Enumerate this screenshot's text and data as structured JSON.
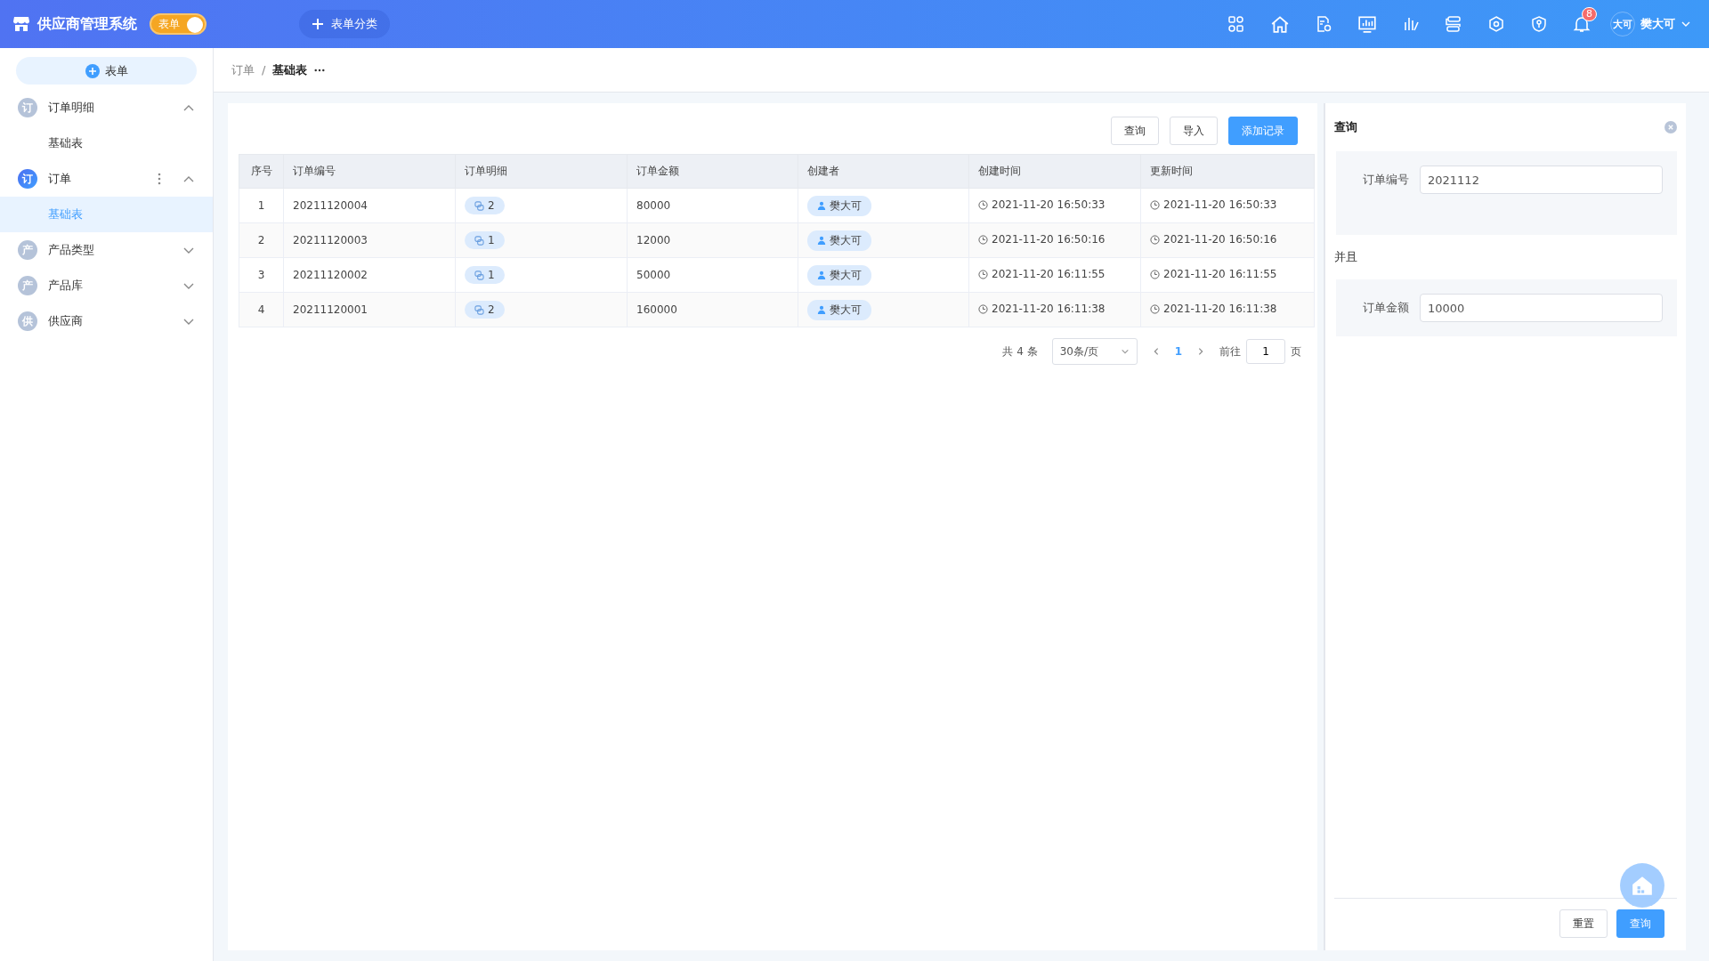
{
  "app": {
    "title": "供应商管理系统",
    "toggle": {
      "label": "表单",
      "on": true
    },
    "category_button": "表单分类"
  },
  "notifications": {
    "count": "8"
  },
  "user": {
    "avatar_text": "大可",
    "name": "樊大可"
  },
  "sidebar": {
    "new_button": "表单",
    "groups": [
      {
        "icon_text": "订",
        "label": "订单明细",
        "active": false,
        "expanded": true,
        "has_more": false,
        "children": [
          {
            "label": "基础表",
            "selected": false
          }
        ]
      },
      {
        "icon_text": "订",
        "label": "订单",
        "active": true,
        "expanded": true,
        "has_more": true,
        "children": [
          {
            "label": "基础表",
            "selected": true
          }
        ]
      },
      {
        "icon_text": "产",
        "label": "产品类型",
        "active": false,
        "expanded": false,
        "has_more": false
      },
      {
        "icon_text": "产",
        "label": "产品库",
        "active": false,
        "expanded": false,
        "has_more": false
      },
      {
        "icon_text": "供",
        "label": "供应商",
        "active": false,
        "expanded": false,
        "has_more": false
      }
    ]
  },
  "breadcrumb": {
    "items": [
      "订单",
      "基础表"
    ],
    "separator": "/"
  },
  "toolbar": [
    {
      "label": "查询",
      "kind": "default"
    },
    {
      "label": "导入",
      "kind": "default"
    },
    {
      "label": "添加记录",
      "kind": "primary"
    }
  ],
  "table": {
    "columns": [
      "序号",
      "订单编号",
      "订单明细",
      "订单金额",
      "创建者",
      "创建时间",
      "更新时间"
    ],
    "rows": [
      {
        "index": "1",
        "order_no": "20211120004",
        "details": "2",
        "amount": "80000",
        "creator": "樊大可",
        "created": "2021-11-20 16:50:33",
        "updated": "2021-11-20 16:50:33"
      },
      {
        "index": "2",
        "order_no": "20211120003",
        "details": "1",
        "amount": "12000",
        "creator": "樊大可",
        "created": "2021-11-20 16:50:16",
        "updated": "2021-11-20 16:50:16"
      },
      {
        "index": "3",
        "order_no": "20211120002",
        "details": "1",
        "amount": "50000",
        "creator": "樊大可",
        "created": "2021-11-20 16:11:55",
        "updated": "2021-11-20 16:11:55"
      },
      {
        "index": "4",
        "order_no": "20211120001",
        "details": "2",
        "amount": "160000",
        "creator": "樊大可",
        "created": "2021-11-20 16:11:38",
        "updated": "2021-11-20 16:11:38"
      }
    ]
  },
  "pagination": {
    "total": "共 4 条",
    "page_size": "30条/页",
    "pages": [
      {
        "label": "1",
        "selected": true
      }
    ],
    "goto_label": "前往",
    "goto_value": "1",
    "page_unit": "页"
  },
  "query_panel": {
    "title": "查询",
    "filters": [
      {
        "label": "订单编号",
        "value": "2021112"
      },
      {
        "label": "订单金额",
        "value": "10000"
      }
    ],
    "connectors": [
      "并且"
    ],
    "buttons": [
      {
        "label": "重置",
        "kind": "default"
      },
      {
        "label": "查询",
        "kind": "primary"
      }
    ]
  }
}
